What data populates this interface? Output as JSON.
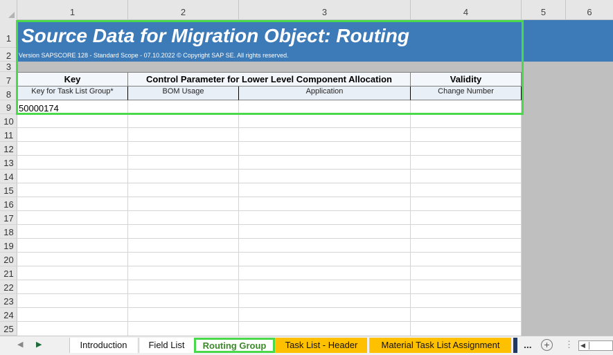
{
  "columns": [
    "1",
    "2",
    "3",
    "4",
    "5",
    "6"
  ],
  "rows": [
    "1",
    "2",
    "3",
    "7",
    "8",
    "9",
    "10",
    "11",
    "12",
    "13",
    "14",
    "15",
    "16",
    "17",
    "18",
    "19",
    "20",
    "21",
    "22",
    "23",
    "24",
    "25"
  ],
  "title": "Source Data for Migration Object:  Routing",
  "version": "Version SAPSCORE 128  - Standard Scope - 07.10.2022 © Copyright SAP SE. All rights reserved.",
  "groups": {
    "key": "Key",
    "control": "Control Parameter for Lower Level Component Allocation",
    "validity": "Validity"
  },
  "subheaders": {
    "task_list_group": "Key for Task List Group*",
    "bom_usage": "BOM Usage",
    "application": "Application",
    "change_number": "Change Number"
  },
  "cells": {
    "row9_col1": "50000174"
  },
  "tabs": [
    {
      "label": "Introduction",
      "style": "white"
    },
    {
      "label": "Field List",
      "style": "white"
    },
    {
      "label": "Routing Group",
      "style": "active"
    },
    {
      "label": "Task List - Header",
      "style": "yellow"
    },
    {
      "label": "Material Task List Assignment",
      "style": "yellow"
    }
  ],
  "tab_more": "...",
  "colors": {
    "title_band": "#3d7ab8",
    "selection": "#4ad94a",
    "tab_yellow": "#ffc000",
    "active_tab_text": "#3a8a2a"
  }
}
